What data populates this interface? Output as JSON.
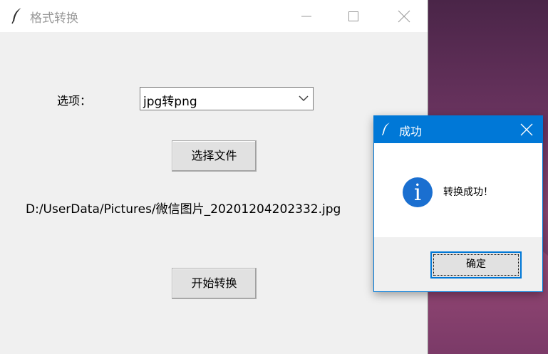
{
  "main_window": {
    "title": "格式转换",
    "option_label": "选项：",
    "combo_value": "jpg转png",
    "select_file_button": "选择文件",
    "file_path": "D:/UserData/Pictures/微信图片_20201204202332.jpg",
    "start_button": "开始转换"
  },
  "dialog": {
    "title": "成功",
    "icon": "info-icon",
    "message": "转换成功！",
    "ok_button": "确定"
  },
  "colors": {
    "accent": "#0078d7",
    "window_bg": "#f0f0f0"
  }
}
